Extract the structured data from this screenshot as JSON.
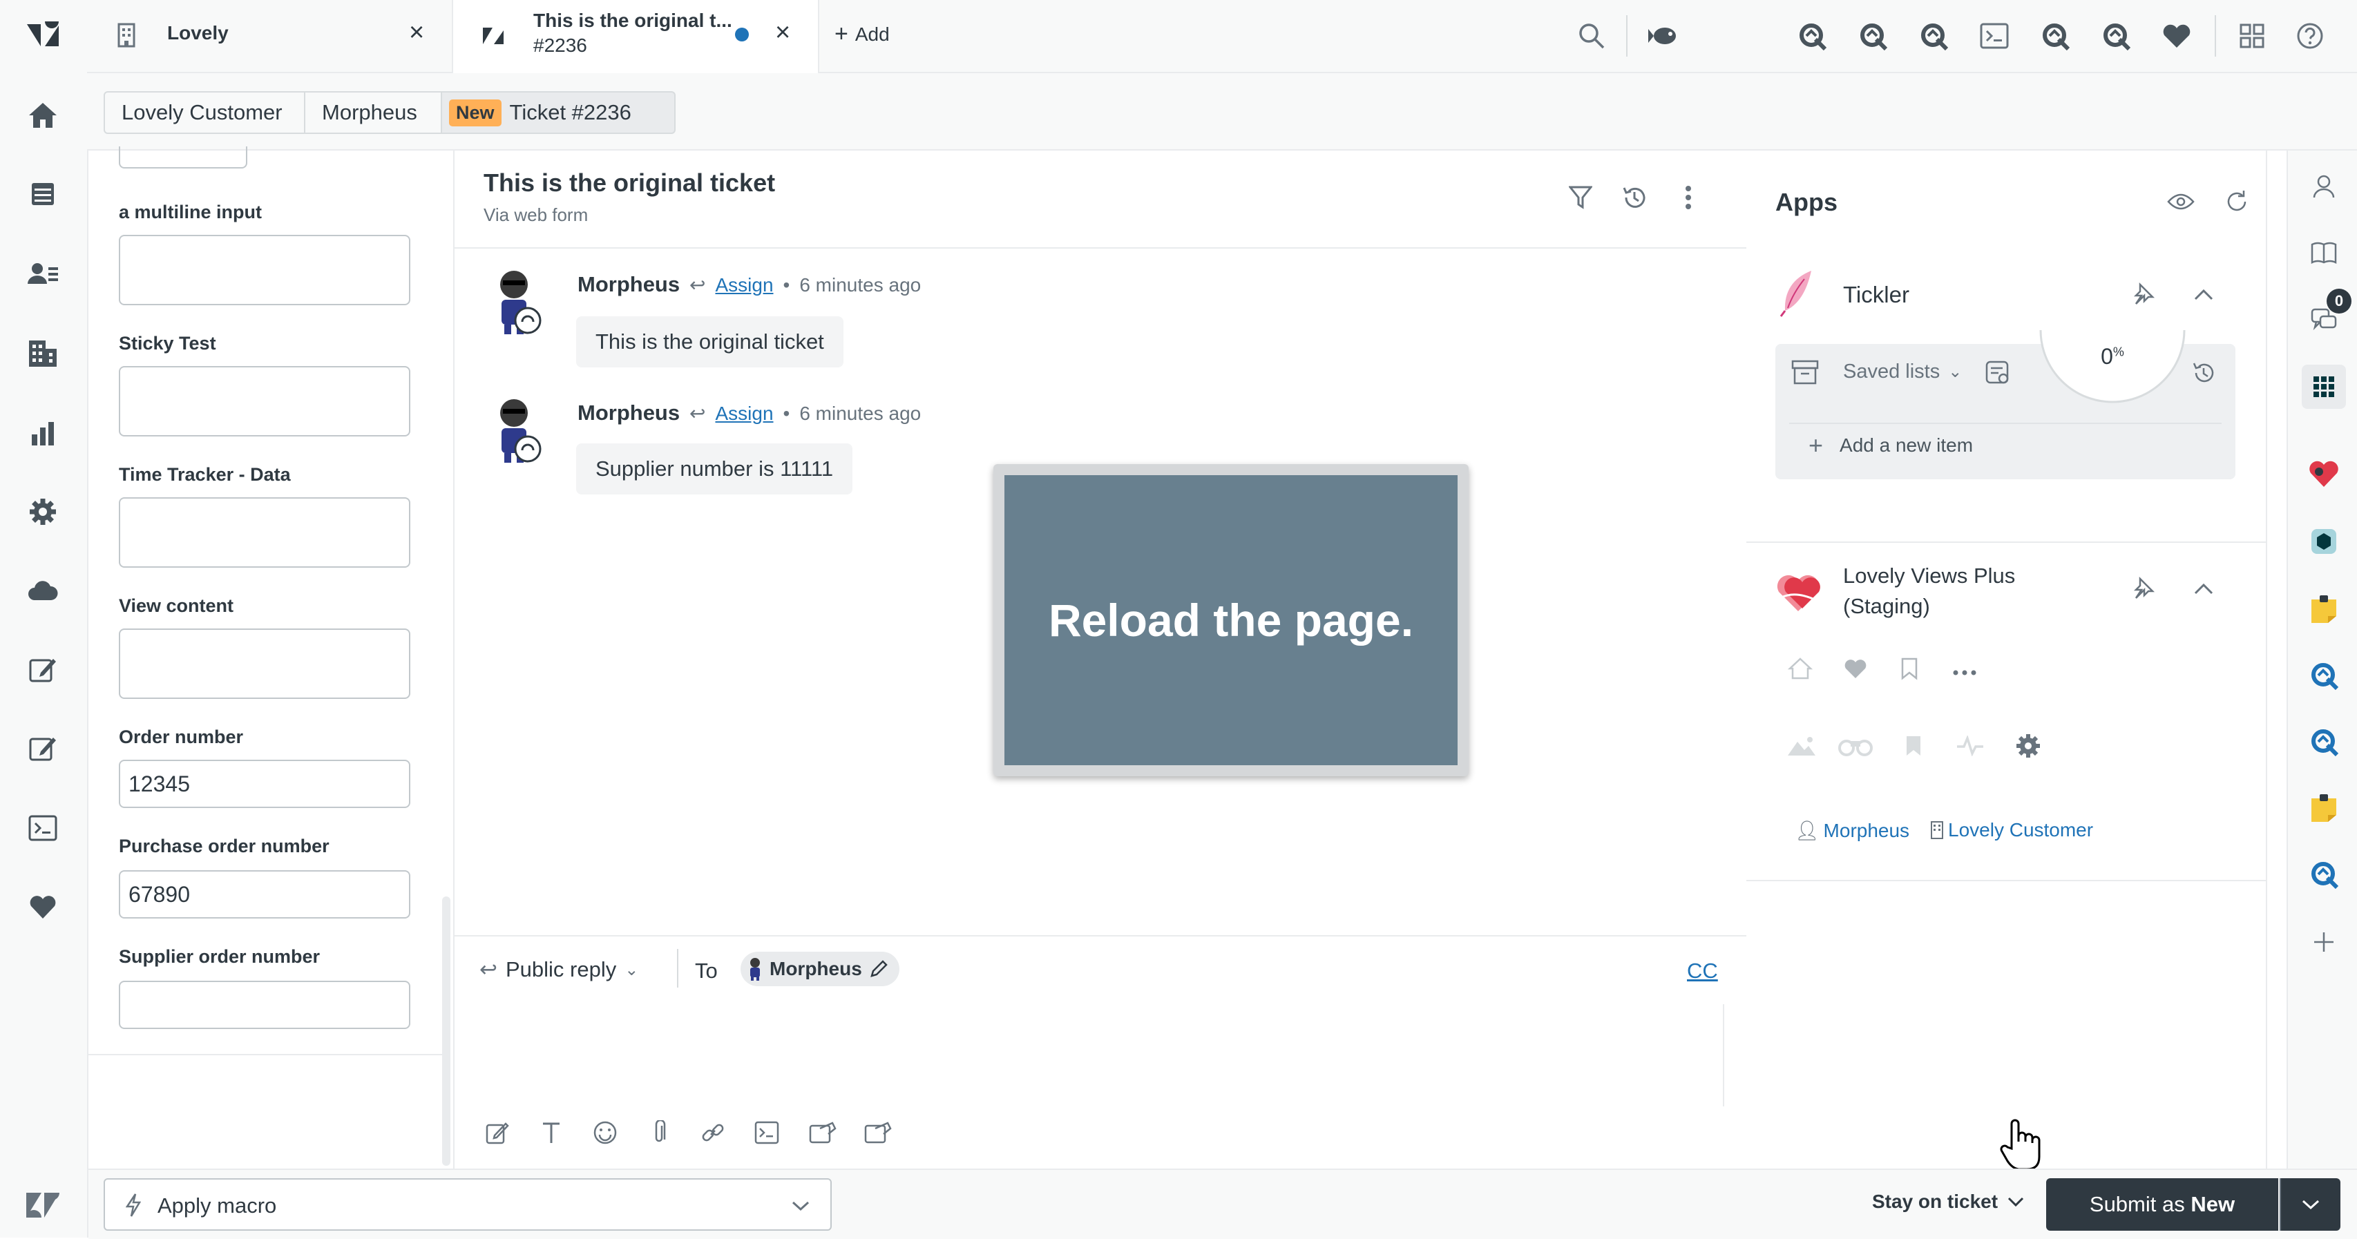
{
  "tabs": [
    {
      "title": "Lovely",
      "close": "×"
    },
    {
      "title": "This is the original t...",
      "subtitle": "#2236",
      "close": "×"
    }
  ],
  "add_tab_label": "Add",
  "breadcrumb": {
    "organization": "Lovely Customer",
    "requester": "Morpheus",
    "status_badge": "New",
    "ticket": "Ticket #2236"
  },
  "fields": [
    {
      "label": "a multiline input",
      "value": ""
    },
    {
      "label": "Sticky Test",
      "value": ""
    },
    {
      "label": "Time Tracker - Data",
      "value": ""
    },
    {
      "label": "View content",
      "value": ""
    },
    {
      "label": "Order number",
      "value": "12345"
    },
    {
      "label": "Purchase order number",
      "value": "67890"
    },
    {
      "label": "Supplier order number",
      "value": ""
    }
  ],
  "ticket": {
    "subject": "This is the original ticket",
    "channel": "Via web form"
  },
  "messages": [
    {
      "author": "Morpheus",
      "assign": "Assign",
      "time": "6 minutes ago",
      "body": "This is the original ticket"
    },
    {
      "author": "Morpheus",
      "assign": "Assign",
      "time": "6 minutes ago",
      "body": "Supplier number is 11111"
    }
  ],
  "reload_message": "Reload the page.",
  "composer": {
    "reply_type": "Public reply",
    "to_label": "To",
    "recipient": "Morpheus",
    "cc_label": "CC"
  },
  "apps_panel": {
    "title": "Apps",
    "tickler": {
      "name": "Tickler",
      "saved_lists_label": "Saved lists",
      "progress": "0",
      "progress_unit": "%",
      "add_item_label": "Add a new item"
    },
    "lovely_views": {
      "name_line1": "Lovely Views Plus",
      "name_line2": "(Staging)",
      "user_link": "Morpheus",
      "org_link": "Lovely Customer"
    }
  },
  "right_rail": {
    "conversations_badge": "0"
  },
  "bottom": {
    "macro_label": "Apply macro",
    "stay_label": "Stay on ticket",
    "submit_prefix": "Submit as ",
    "submit_status": "New"
  },
  "colors": {
    "brand_dark": "#03363d",
    "link_blue": "#1f73b7",
    "new_badge": "#ffb057",
    "reload_bg": "#68808f",
    "submit_bg": "#2f3941"
  }
}
